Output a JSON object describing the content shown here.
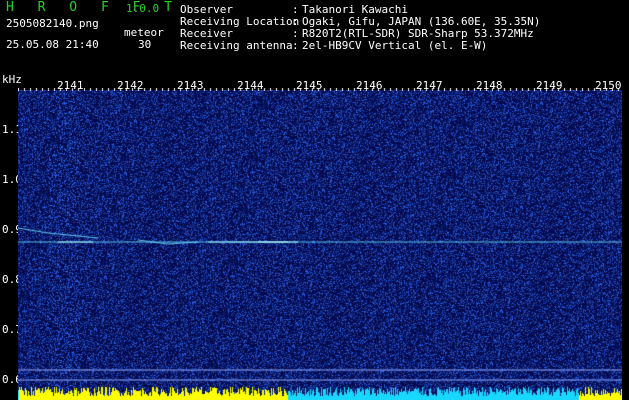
{
  "header": {
    "app_title": "H R O F F T",
    "version": "1.0.0",
    "filename": "2505082140.png",
    "datetime": "25.05.08 21:40",
    "meteor_label": "meteor",
    "meteor_count": "30"
  },
  "info": [
    {
      "label": "Observer",
      "value": "Takanori Kawachi"
    },
    {
      "label": "Receiving Location",
      "value": "Ogaki, Gifu, JAPAN (136.60E, 35.35N)"
    },
    {
      "label": "Receiver",
      "value": "R820T2(RTL-SDR) SDR-Sharp 53.372MHz"
    },
    {
      "label": "Receiving antenna",
      "value": "2el-HB9CV Vertical (el. E-W)"
    }
  ],
  "spectrogram": {
    "y_unit": "kHz",
    "y_labels": [
      "1.1",
      "1.0",
      "0.9",
      "0.8",
      "0.7",
      "0.6"
    ],
    "x_labels": [
      "2141",
      "2142",
      "2143",
      "2144",
      "2145",
      "2146",
      "2147",
      "2148",
      "2149",
      "2150"
    ],
    "colors": {
      "background": "#030a4e",
      "noise": "#1c3ab8",
      "signal": "#6fe3ff",
      "bar": "#ffff00",
      "bar_alt": "#18d8ff"
    }
  }
}
